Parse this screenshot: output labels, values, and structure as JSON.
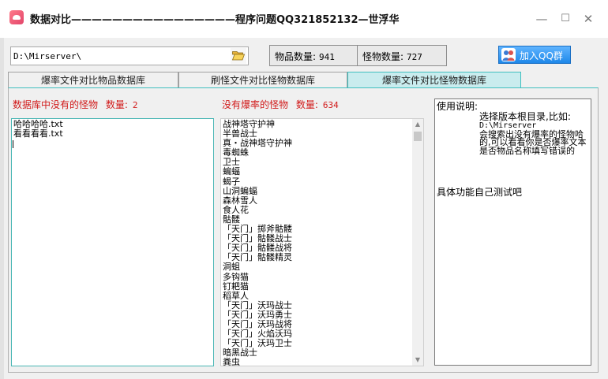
{
  "window": {
    "title": "数据对比————————————————程序问题QQ321852132—世浮华",
    "minimize_glyph": "—",
    "maximize_glyph": "☐",
    "close_glyph": "✕"
  },
  "toolbar": {
    "path_value": "D:\\Mirserver\\",
    "folder_icon": "folder-open-icon",
    "item_count_label": "物品数量:",
    "item_count": "941",
    "monster_count_label": "怪物数量:",
    "monster_count": "727",
    "qq_button_label": "加入QQ群",
    "qq_icon": "qq-group-icon"
  },
  "tabs": [
    {
      "label": "爆率文件对比物品数据库",
      "active": false
    },
    {
      "label": "刷怪文件对比怪物数据库",
      "active": false
    },
    {
      "label": "爆率文件对比怪物数据库",
      "active": true
    }
  ],
  "left_panel": {
    "heading": "数据库中没有的怪物",
    "count_label": "数量:",
    "count": "2",
    "items": [
      "哈哈哈哈.txt",
      "看看看看.txt"
    ]
  },
  "mid_panel": {
    "heading": "没有爆率的怪物",
    "count_label": "数量:",
    "count": "634",
    "items": [
      "战神塔守护神",
      "半兽战士",
      "真・战神塔守护神",
      "毒蜘蛛",
      "卫士",
      "蝙蝠",
      "蝎子",
      "山洞蝙蝠",
      "森林雪人",
      "食人花",
      "骷髅",
      "「天门」掷斧骷髅",
      "「天门」骷髅战士",
      "「天门」骷髅战将",
      "「天门」骷髅精灵",
      "洞蛆",
      "多钩猫",
      "钉耙猫",
      "稻草人",
      "「天门」沃玛战士",
      "「天门」沃玛勇士",
      "「天门」沃玛战将",
      "「天门」火焰沃玛",
      "「天门」沃玛卫士",
      "暗黑战士",
      "粪虫"
    ]
  },
  "help": {
    "title": "使用说明:",
    "line1": "选择版本根目录,比如:",
    "path": "D:\\Mirserver",
    "line2": "会搜索出没有爆率的怪物哈的,可以看看你是否爆率文本是否物品名称填写错误的",
    "note": "具体功能自己测试吧"
  }
}
